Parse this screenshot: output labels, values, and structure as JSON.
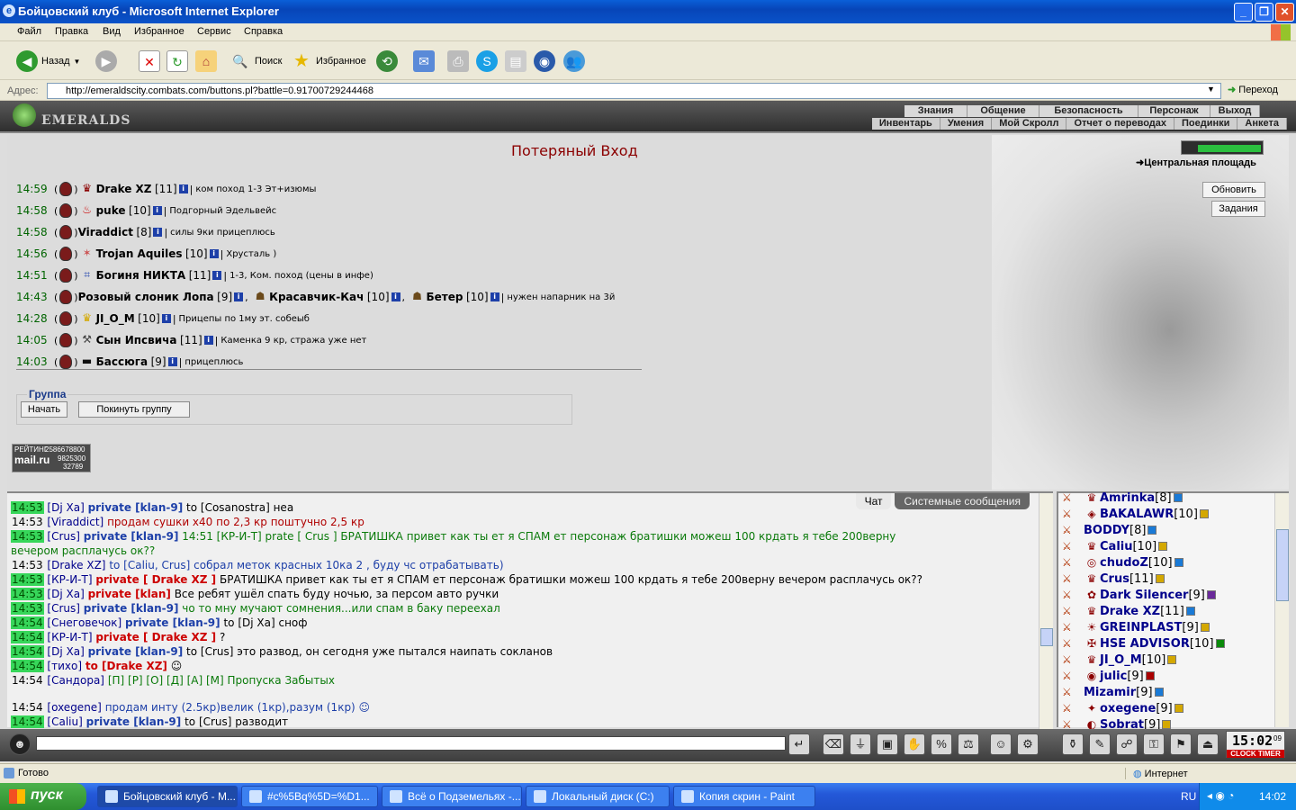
{
  "window": {
    "title": "Бойцовский клуб - Microsoft Internet Explorer"
  },
  "menu": [
    "Файл",
    "Правка",
    "Вид",
    "Избранное",
    "Сервис",
    "Справка"
  ],
  "toolbar": {
    "back": "Назад",
    "search": "Поиск",
    "favorites": "Избранное"
  },
  "address": {
    "label": "Адрес:",
    "url": "http://emeraldscity.combats.com/buttons.pl?battle=0.91700729244468",
    "go": "Переход"
  },
  "game": {
    "logo": "EMERALDS",
    "nav_top": [
      "Знания",
      "Общение",
      "Безопасность",
      "Персонаж",
      "Выход"
    ],
    "nav_bottom": [
      "Инвентарь",
      "Умения",
      "Мой Скролл",
      "Отчет о переводах",
      "Поединки",
      "Анкета"
    ],
    "page_title": "Потеряный Вход",
    "location": "Центральная площадь",
    "buttons": {
      "refresh": "Обновить",
      "tasks": "Задания"
    },
    "requests": [
      {
        "time": "14:59",
        "players": [
          {
            "nick": "Drake XZ",
            "level": "[11]"
          }
        ],
        "comment": "ком поход 1-3 Эт+изюмы"
      },
      {
        "time": "14:58",
        "players": [
          {
            "nick": "puke",
            "level": "[10]"
          }
        ],
        "comment": "Подгорный Эдельвейс"
      },
      {
        "time": "14:58",
        "players": [
          {
            "nick": "Viraddict",
            "level": "[8]"
          }
        ],
        "comment": "силы 9ки прицеплюсь"
      },
      {
        "time": "14:56",
        "players": [
          {
            "nick": "Trojan Aquiles",
            "level": "[10]"
          }
        ],
        "comment": "Хрусталь )"
      },
      {
        "time": "14:51",
        "players": [
          {
            "nick": "Богиня НИКТА",
            "level": "[11]"
          }
        ],
        "comment": "1-3, Ком. поход (цены в инфе)"
      },
      {
        "time": "14:43",
        "players": [
          {
            "nick": "Розовый слоник Лопа",
            "level": "[9]"
          },
          {
            "nick": "Красавчик-Кач",
            "level": "[10]"
          },
          {
            "nick": "Бетер",
            "level": "[10]"
          }
        ],
        "comment": "нужен напарник на 3й"
      },
      {
        "time": "14:28",
        "players": [
          {
            "nick": "JI_O_M",
            "level": "[10]"
          }
        ],
        "comment": "Прицепы по 1му эт. собеыб"
      },
      {
        "time": "14:05",
        "players": [
          {
            "nick": "Сын Ипсвича",
            "level": "[11]"
          }
        ],
        "comment": "Каменка 9 кр, стража уже нет"
      },
      {
        "time": "14:03",
        "players": [
          {
            "nick": "Бассюга",
            "level": "[9]"
          }
        ],
        "comment": "прицеплюсь"
      }
    ],
    "group": {
      "title": "Группа",
      "start": "Начать",
      "leave": "Покинуть группу"
    },
    "rating": {
      "label": "РЕЙТИНГ",
      "brand": "mail.ru",
      "n1": "2586678800",
      "n2": "9825300",
      "n3": "32789"
    }
  },
  "chat": {
    "tabs": [
      "Чат",
      "Системные сообщения"
    ],
    "lines": [
      {
        "time": "14:53",
        "hl": true,
        "nick": "[Dj Xa]",
        "priv": "private [klan-9]",
        "rest": " to [Cosanostra] неа",
        "style": ""
      },
      {
        "time": "14:53",
        "hl": false,
        "nick": "[Viraddict]",
        "priv": "",
        "rest": " продам сушки х40 по 2,3 кр поштучно 2,5 кр",
        "style": "red"
      },
      {
        "time": "14:53",
        "hl": true,
        "nick": "[Crus]",
        "priv": "private [klan-9]",
        "rest": " 14:51 [КР-И-Т] prate [ Crus ] БРАТИШКА привет как ты ет я СПАМ ет персонаж братишки можеш 100 крдать я тебе 200верну",
        "style": "green"
      },
      {
        "time": "",
        "hl": false,
        "nick": "",
        "priv": "",
        "rest": "вечером расплачусь ок??",
        "style": "green"
      },
      {
        "time": "14:53",
        "hl": false,
        "nick": "[Drake XZ]",
        "priv": "",
        "rest": " to [Caliu, Crus] собрал меток красных 10ка 2 , буду чс отрабатывать)",
        "style": "blue"
      },
      {
        "time": "14:53",
        "hl": true,
        "nick": "[КР-И-Т]",
        "priv": "private [ Drake XZ ]",
        "rest": " БРАТИШКА привет как ты ет я СПАМ ет персонаж братишки можеш 100 крдать я тебе 200верну вечером расплачусь ок??",
        "style": "",
        "privred": true
      },
      {
        "time": "14:53",
        "hl": true,
        "nick": "[Dj Xa]",
        "priv": "private [klan]",
        "rest": " Все ребят ушёл спать буду ночью, за персом авто ручки",
        "style": "",
        "privred": true
      },
      {
        "time": "14:53",
        "hl": true,
        "nick": "[Crus]",
        "priv": "private [klan-9]",
        "rest": " чо то мну мучают сомнения...или спам в баку переехал",
        "style": "green"
      },
      {
        "time": "14:54",
        "hl": true,
        "nick": "[Снеговечок]",
        "priv": "private [klan-9]",
        "rest": " to [Dj Xa] сноф",
        "style": ""
      },
      {
        "time": "14:54",
        "hl": true,
        "nick": "[КР-И-Т]",
        "priv": "private [ Drake XZ ]",
        "rest": " ?",
        "style": "",
        "privred": true
      },
      {
        "time": "14:54",
        "hl": true,
        "nick": "[Dj Xa]",
        "priv": "private [klan-9]",
        "rest": " to [Crus] это развод, он сегодня уже пытался наипать сокланов",
        "style": ""
      },
      {
        "time": "14:54",
        "hl": true,
        "nick": "[тихо]",
        "priv": "to [Drake XZ]",
        "rest": " ☺",
        "style": "",
        "privred": true
      },
      {
        "time": "14:54",
        "hl": false,
        "nick": "[Сандора]",
        "priv": "",
        "rest": " [П] [Р] [О] [Д] [А] [М] Пропуска Забытых",
        "style": "green"
      },
      {
        "time": "14:54",
        "hl": false,
        "nick": "[oxegene]",
        "priv": "",
        "rest": " продам инту (2.5кр)велик (1кр),разум (1кр) ☺",
        "style": "blue"
      },
      {
        "time": "14:54",
        "hl": true,
        "nick": "[Caliu]",
        "priv": "private [klan-9]",
        "rest": " to [Crus] разводит",
        "style": ""
      }
    ]
  },
  "users": [
    {
      "name": "Amrinka",
      "level": "[8]",
      "icon": "blue"
    },
    {
      "name": "BAKALAWR",
      "level": "[10]",
      "icon": ""
    },
    {
      "name": "BODDY",
      "level": "[8]",
      "icon": "blue"
    },
    {
      "name": "Caliu",
      "level": "[10]",
      "icon": ""
    },
    {
      "name": "chudoZ",
      "level": "[10]",
      "icon": "blue"
    },
    {
      "name": "Crus",
      "level": "[11]",
      "icon": ""
    },
    {
      "name": "Dark Silencer",
      "level": "[9]",
      "icon": "purple"
    },
    {
      "name": "Drake XZ",
      "level": "[11]",
      "icon": "blue"
    },
    {
      "name": "GREINPLAST",
      "level": "[9]",
      "icon": ""
    },
    {
      "name": "HSE ADVISOR",
      "level": "[10]",
      "icon": "green"
    },
    {
      "name": "JI_O_M",
      "level": "[10]",
      "icon": ""
    },
    {
      "name": "julic",
      "level": "[9]",
      "icon": "red"
    },
    {
      "name": "Mizamir",
      "level": "[9]",
      "icon": "blue"
    },
    {
      "name": "oxegene",
      "level": "[9]",
      "icon": ""
    },
    {
      "name": "Sobrat",
      "level": "[9]",
      "icon": ""
    }
  ],
  "clock": {
    "time": "15:02",
    "sec": "09",
    "label": "CLOCK TIMER"
  },
  "status": {
    "text": "Готово",
    "zone": "Интернет"
  },
  "taskbar": {
    "start": "пуск",
    "tasks": [
      "Бойцовский клуб - M...",
      "#c%5Bq%5D=%D1...",
      "Всё о Подземельях -...",
      "Локальный диск (C:)",
      "Копия скрин - Paint"
    ],
    "lang": "RU",
    "time": "14:02"
  },
  "colors": {
    "xp_blue": "#0a53c9",
    "chat_highlight": "#37d65a",
    "title_red": "#8b0000"
  }
}
